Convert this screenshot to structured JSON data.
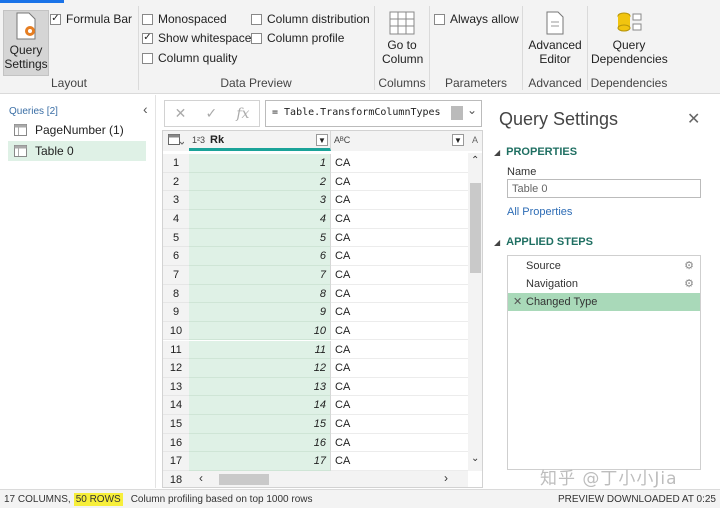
{
  "ribbon": {
    "layout": {
      "label": "Layout",
      "query_settings": "Query Settings",
      "formula_bar": "Formula Bar"
    },
    "data_preview": {
      "label": "Data Preview",
      "monospaced": "Monospaced",
      "show_whitespace": "Show whitespace",
      "column_quality": "Column quality",
      "column_distribution": "Column distribution",
      "column_profile": "Column profile"
    },
    "columns": {
      "label": "Columns",
      "go_to_column": "Go to Column"
    },
    "parameters": {
      "label": "Parameters",
      "always_allow": "Always allow"
    },
    "advanced": {
      "label": "Advanced",
      "advanced_editor": "Advanced Editor"
    },
    "dependencies": {
      "label": "Dependencies",
      "query_dependencies": "Query Dependencies"
    }
  },
  "queries": {
    "header": "Queries [2]",
    "items": [
      {
        "label": "PageNumber (1)"
      },
      {
        "label": "Table 0"
      }
    ]
  },
  "formula": {
    "text": "= Table.TransformColumnTypes",
    "fx": "fx"
  },
  "grid": {
    "col1": {
      "type": "1²3",
      "name": "Rk"
    },
    "col2": {
      "type": "AᴮC",
      "name": ""
    },
    "rows": [
      {
        "n": "1",
        "rk": "1",
        "st": "CA"
      },
      {
        "n": "2",
        "rk": "2",
        "st": "CA"
      },
      {
        "n": "3",
        "rk": "3",
        "st": "CA"
      },
      {
        "n": "4",
        "rk": "4",
        "st": "CA"
      },
      {
        "n": "5",
        "rk": "5",
        "st": "CA"
      },
      {
        "n": "6",
        "rk": "6",
        "st": "CA"
      },
      {
        "n": "7",
        "rk": "7",
        "st": "CA"
      },
      {
        "n": "8",
        "rk": "8",
        "st": "CA"
      },
      {
        "n": "9",
        "rk": "9",
        "st": "CA"
      },
      {
        "n": "10",
        "rk": "10",
        "st": "CA"
      },
      {
        "n": "11",
        "rk": "11",
        "st": "CA"
      },
      {
        "n": "12",
        "rk": "12",
        "st": "CA"
      },
      {
        "n": "13",
        "rk": "13",
        "st": "CA"
      },
      {
        "n": "14",
        "rk": "14",
        "st": "CA"
      },
      {
        "n": "15",
        "rk": "15",
        "st": "CA"
      },
      {
        "n": "16",
        "rk": "16",
        "st": "CA"
      },
      {
        "n": "17",
        "rk": "17",
        "st": "CA"
      },
      {
        "n": "18",
        "rk": "",
        "st": ""
      }
    ]
  },
  "settings": {
    "title": "Query Settings",
    "properties": "PROPERTIES",
    "name_label": "Name",
    "name_value": "Table 0",
    "all_properties": "All Properties",
    "applied_steps": "APPLIED STEPS",
    "steps": [
      {
        "label": "Source"
      },
      {
        "label": "Navigation"
      },
      {
        "label": "Changed Type"
      }
    ]
  },
  "watermark": "知乎 @丁小小Jia",
  "status": {
    "columns": "17 COLUMNS,",
    "rows": "50 ROWS",
    "profiling": "Column profiling based on top 1000 rows",
    "preview": "PREVIEW DOWNLOADED AT 0:25"
  },
  "colors": {
    "accent": "#1ba399",
    "selected_col": "#dff1e6",
    "section_title": "#1f6f62",
    "highlight": "#f7ef3a"
  }
}
